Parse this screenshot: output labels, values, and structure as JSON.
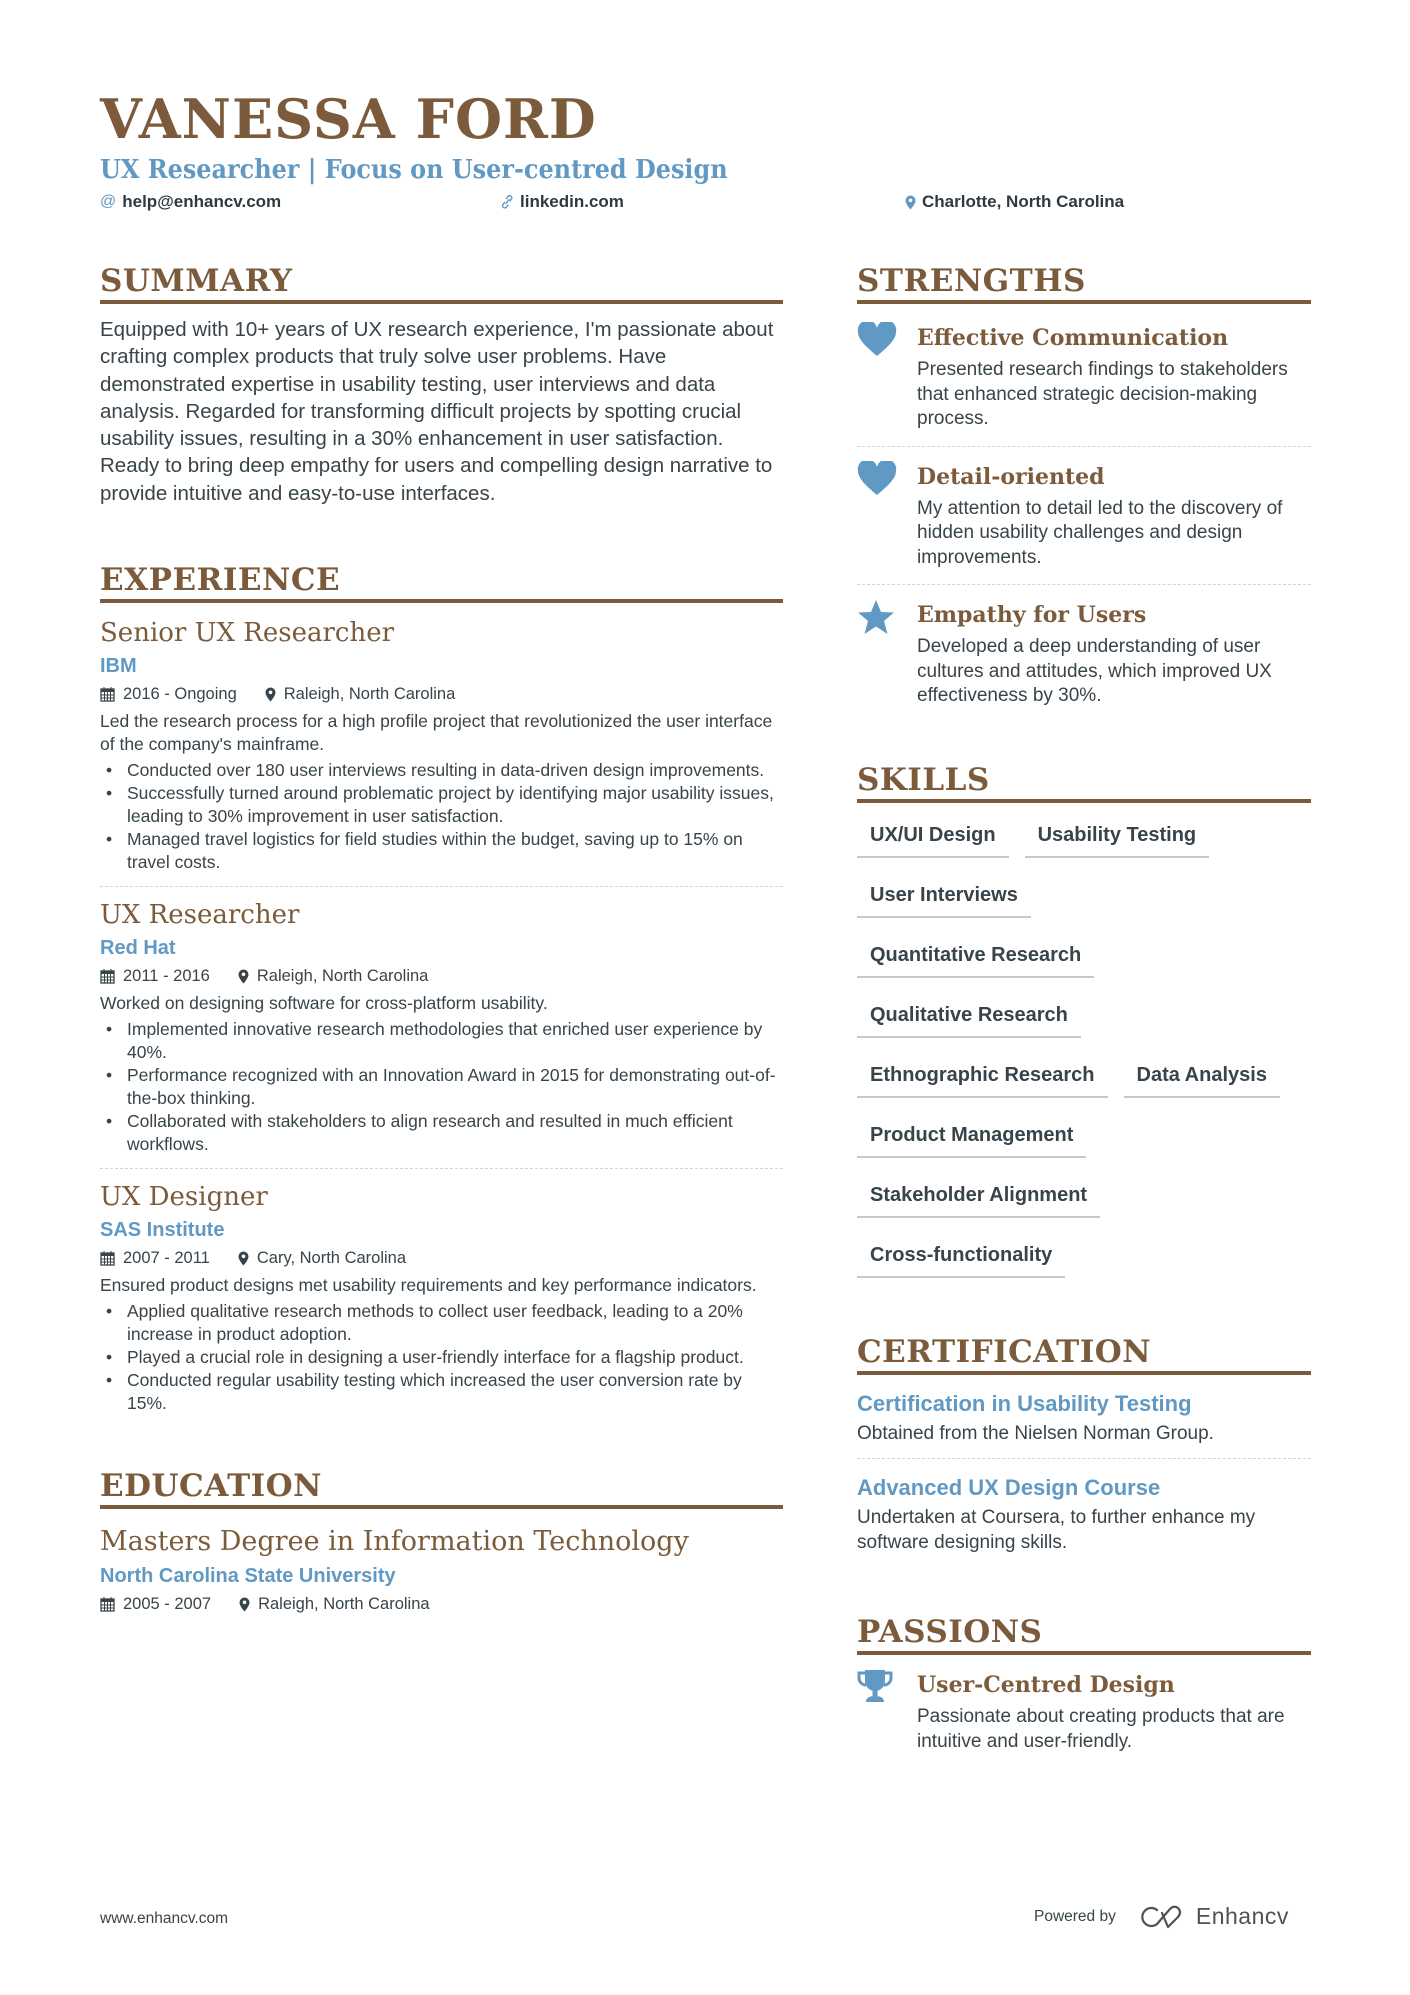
{
  "header": {
    "name": "VANESSA FORD",
    "subtitle": "UX Researcher | Focus on User-centred Design",
    "contacts": [
      {
        "icon": "at-icon",
        "text": "help@enhancv.com"
      },
      {
        "icon": "link-icon",
        "text": "linkedin.com"
      },
      {
        "icon": "location-pin-icon",
        "text": "Charlotte, North Carolina"
      }
    ]
  },
  "colors": {
    "accent_brown": "#7b5b3b",
    "accent_blue": "#6099c4",
    "text": "#38444a"
  },
  "summary": {
    "title": "SUMMARY",
    "text": "Equipped with 10+ years of UX research experience, I'm passionate about crafting complex products that truly solve user problems. Have demonstrated expertise in usability testing, user interviews and data analysis. Regarded for transforming difficult projects by spotting crucial usability issues, resulting in a 30% enhancement in user satisfaction. Ready to bring deep empathy for users and compelling design narrative to provide intuitive and easy-to-use interfaces."
  },
  "experience": {
    "title": "EXPERIENCE",
    "items": [
      {
        "role": "Senior UX Researcher",
        "company": "IBM",
        "dates": "2016 - Ongoing",
        "location": "Raleigh, North Carolina",
        "description": "Led the research process for a high profile project that revolutionized the user interface of the company's mainframe.",
        "bullets": [
          "Conducted over 180 user interviews resulting in data-driven design improvements.",
          "Successfully turned around problematic project by identifying major usability issues, leading to 30% improvement in user satisfaction.",
          "Managed travel logistics for field studies within the budget, saving up to 15% on travel costs."
        ]
      },
      {
        "role": "UX Researcher",
        "company": "Red Hat",
        "dates": "2011 - 2016",
        "location": "Raleigh, North Carolina",
        "description": "Worked on designing software for cross-platform usability.",
        "bullets": [
          "Implemented innovative research methodologies that enriched user experience by 40%.",
          "Performance recognized with an Innovation Award in 2015 for demonstrating out-of-the-box thinking.",
          "Collaborated with stakeholders to align research and resulted in much efficient workflows."
        ]
      },
      {
        "role": "UX Designer",
        "company": "SAS Institute",
        "dates": "2007 - 2011",
        "location": "Cary, North Carolina",
        "description": "Ensured product designs met usability requirements and key performance indicators.",
        "bullets": [
          "Applied qualitative research methods to collect user feedback, leading to a 20% increase in product adoption.",
          "Played a crucial role in designing a user-friendly interface for a flagship product.",
          "Conducted regular usability testing which increased the user conversion rate by 15%."
        ]
      }
    ]
  },
  "education": {
    "title": "EDUCATION",
    "degree": "Masters Degree in Information Technology",
    "school": "North Carolina State University",
    "dates": "2005 - 2007",
    "location": "Raleigh, North Carolina"
  },
  "strengths": {
    "title": "STRENGTHS",
    "items": [
      {
        "icon": "heart-icon",
        "title": "Effective Communication",
        "description": "Presented research findings to stakeholders that enhanced strategic decision-making process."
      },
      {
        "icon": "heart-icon",
        "title": "Detail-oriented",
        "description": "My attention to detail led to the discovery of hidden usability challenges and design improvements."
      },
      {
        "icon": "star-icon",
        "title": "Empathy for Users",
        "description": "Developed a deep understanding of user cultures and attitudes, which improved UX effectiveness by 30%."
      }
    ]
  },
  "skills": {
    "title": "SKILLS",
    "items": [
      "UX/UI Design",
      "Usability Testing",
      "User Interviews",
      "Quantitative Research",
      "Qualitative Research",
      "Ethnographic Research",
      "Data Analysis",
      "Product Management",
      "Stakeholder Alignment",
      "Cross-functionality"
    ]
  },
  "certification": {
    "title": "CERTIFICATION",
    "items": [
      {
        "title": "Certification in Usability Testing",
        "description": "Obtained from the Nielsen Norman Group."
      },
      {
        "title": "Advanced UX Design Course",
        "description": "Undertaken at Coursera, to further enhance my software designing skills."
      }
    ]
  },
  "passions": {
    "title": "PASSIONS",
    "items": [
      {
        "icon": "trophy-icon",
        "title": "User-Centred Design",
        "description": "Passionate about creating products that are intuitive and user-friendly."
      }
    ]
  },
  "footer": {
    "website": "www.enhancv.com",
    "powered_by": "Powered by",
    "brand": "Enhancv"
  }
}
